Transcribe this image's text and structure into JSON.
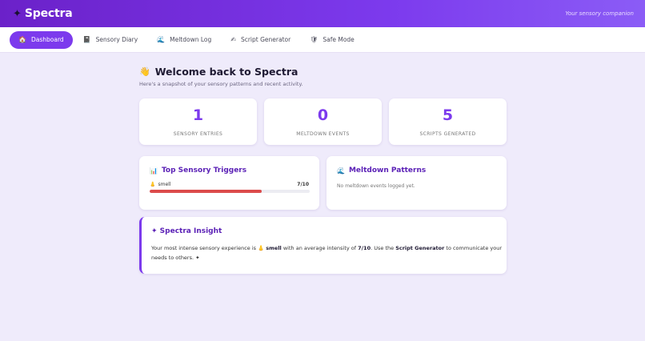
{
  "app": {
    "name": "Spectra",
    "tagline": "Your sensory companion",
    "logo_glyph": "✦"
  },
  "nav": [
    {
      "label": "Dashboard",
      "icon": "🏠",
      "active": true
    },
    {
      "label": "Sensory Diary",
      "icon": "📓",
      "active": false
    },
    {
      "label": "Meltdown Log",
      "icon": "🌊",
      "active": false
    },
    {
      "label": "Script Generator",
      "icon": "✍",
      "active": false
    },
    {
      "label": "Safe Mode",
      "icon": "🛡",
      "active": false
    }
  ],
  "page": {
    "title_icon": "👋",
    "title": "Welcome back to Spectra",
    "subtitle": "Here's a snapshot of your sensory patterns and recent activity."
  },
  "stats": [
    {
      "value": "1",
      "label": "SENSORY ENTRIES"
    },
    {
      "value": "0",
      "label": "MELTDOWN EVENTS"
    },
    {
      "value": "5",
      "label": "SCRIPTS GENERATED"
    }
  ],
  "triggers": {
    "title_icon": "📊",
    "title": "Top Sensory Triggers",
    "items": [
      {
        "icon": "👃",
        "name": "smell",
        "value_text": "7/10",
        "intensity": 0.7
      }
    ]
  },
  "patterns": {
    "title_icon": "🌊",
    "title": "Meltdown Patterns",
    "empty_text": "No meltdown events logged yet."
  },
  "insight": {
    "title": "✦ Spectra Insight",
    "text_1": "Your most intense sensory experience is ",
    "trigger_icon": "👃",
    "trigger": "smell",
    "text_2": " with an average intensity of ",
    "intensity": "7/10",
    "text_3": ". Use the ",
    "tool": "Script Generator",
    "text_4": " to communicate your needs to others. ✦"
  },
  "colors": {
    "accent": "#7c3aed",
    "header_start": "#6b21c9",
    "header_end": "#8b5cf6",
    "bar": "#dc4b4b",
    "background": "#efebfb"
  }
}
